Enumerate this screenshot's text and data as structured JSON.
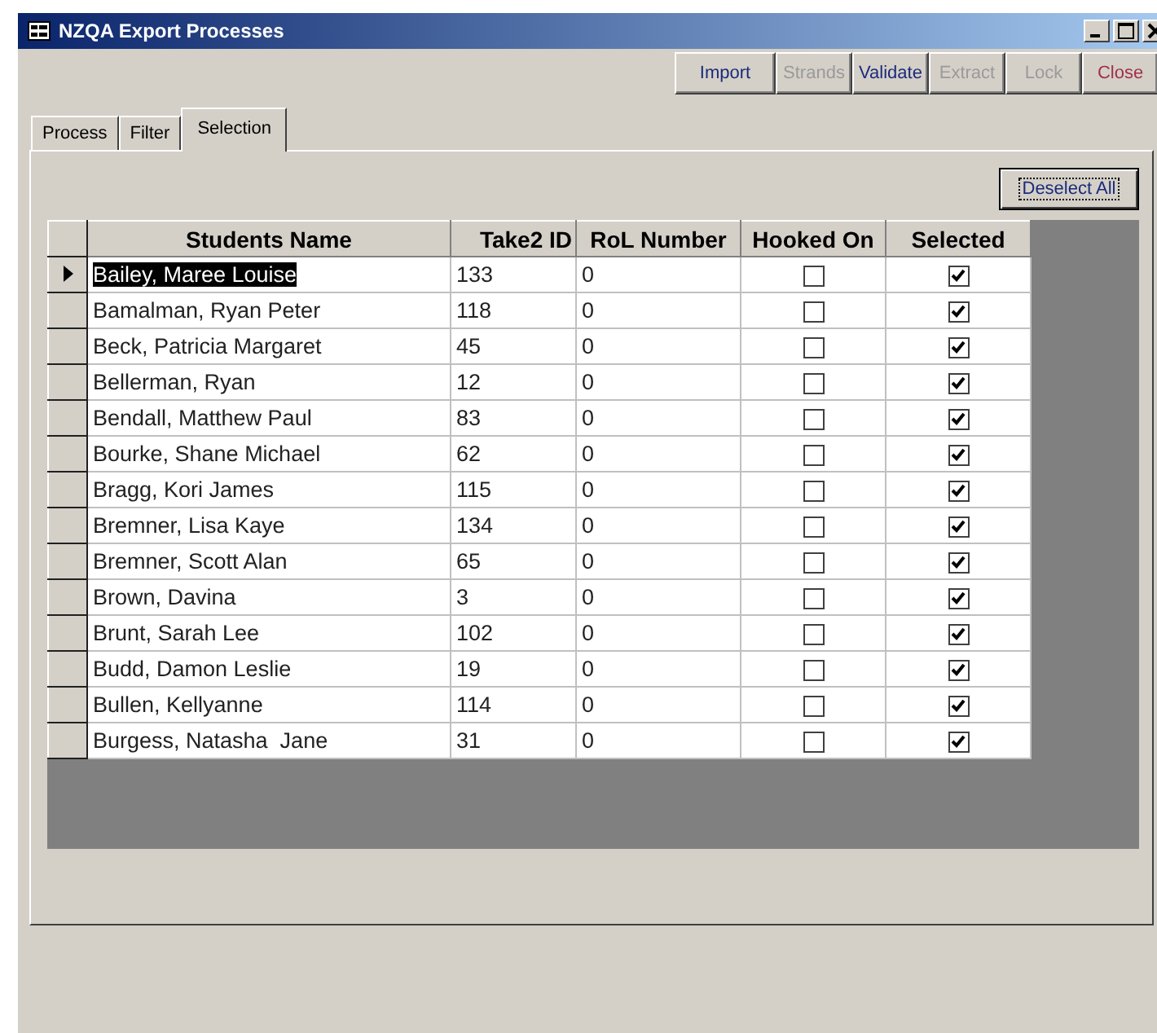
{
  "window": {
    "title": "NZQA Export Processes"
  },
  "toolbar": [
    {
      "label": "Import",
      "kind": "action",
      "disabled": false
    },
    {
      "label": "Strands",
      "kind": "action",
      "disabled": true
    },
    {
      "label": "Validate",
      "kind": "action",
      "disabled": false
    },
    {
      "label": "Extract",
      "kind": "action",
      "disabled": true
    },
    {
      "label": "Lock",
      "kind": "action",
      "disabled": true
    },
    {
      "label": "Close",
      "kind": "close",
      "disabled": false
    }
  ],
  "tabs": [
    {
      "label": "Process",
      "selected": false
    },
    {
      "label": "Filter",
      "selected": false
    },
    {
      "label": "Selection",
      "selected": true
    }
  ],
  "deselect_button": "Deselect All",
  "table": {
    "columns": [
      "Students Name",
      "Take2 ID",
      "RoL Number",
      "Hooked On",
      "Selected"
    ],
    "rows": [
      {
        "name": "Bailey, Maree Louise",
        "take2_id": "133",
        "rol_number": "0",
        "hooked_on": false,
        "selected_flag": true,
        "current": true
      },
      {
        "name": "Bamalman, Ryan Peter",
        "take2_id": "118",
        "rol_number": "0",
        "hooked_on": false,
        "selected_flag": true,
        "current": false
      },
      {
        "name": "Beck, Patricia Margaret",
        "take2_id": "45",
        "rol_number": "0",
        "hooked_on": false,
        "selected_flag": true,
        "current": false
      },
      {
        "name": "Bellerman, Ryan",
        "take2_id": "12",
        "rol_number": "0",
        "hooked_on": false,
        "selected_flag": true,
        "current": false
      },
      {
        "name": "Bendall, Matthew Paul",
        "take2_id": "83",
        "rol_number": "0",
        "hooked_on": false,
        "selected_flag": true,
        "current": false
      },
      {
        "name": "Bourke, Shane Michael",
        "take2_id": "62",
        "rol_number": "0",
        "hooked_on": false,
        "selected_flag": true,
        "current": false
      },
      {
        "name": "Bragg, Kori James",
        "take2_id": "115",
        "rol_number": "0",
        "hooked_on": false,
        "selected_flag": true,
        "current": false
      },
      {
        "name": "Bremner, Lisa Kaye",
        "take2_id": "134",
        "rol_number": "0",
        "hooked_on": false,
        "selected_flag": true,
        "current": false
      },
      {
        "name": "Bremner, Scott Alan",
        "take2_id": "65",
        "rol_number": "0",
        "hooked_on": false,
        "selected_flag": true,
        "current": false
      },
      {
        "name": "Brown, Davina",
        "take2_id": "3",
        "rol_number": "0",
        "hooked_on": false,
        "selected_flag": true,
        "current": false
      },
      {
        "name": "Brunt, Sarah Lee",
        "take2_id": "102",
        "rol_number": "0",
        "hooked_on": false,
        "selected_flag": true,
        "current": false
      },
      {
        "name": "Budd, Damon Leslie",
        "take2_id": "19",
        "rol_number": "0",
        "hooked_on": false,
        "selected_flag": true,
        "current": false
      },
      {
        "name": "Bullen, Kellyanne",
        "take2_id": "114",
        "rol_number": "0",
        "hooked_on": false,
        "selected_flag": true,
        "current": false
      },
      {
        "name": "Burgess, Natasha  Jane",
        "take2_id": "31",
        "rol_number": "0",
        "hooked_on": false,
        "selected_flag": true,
        "current": false
      }
    ]
  }
}
